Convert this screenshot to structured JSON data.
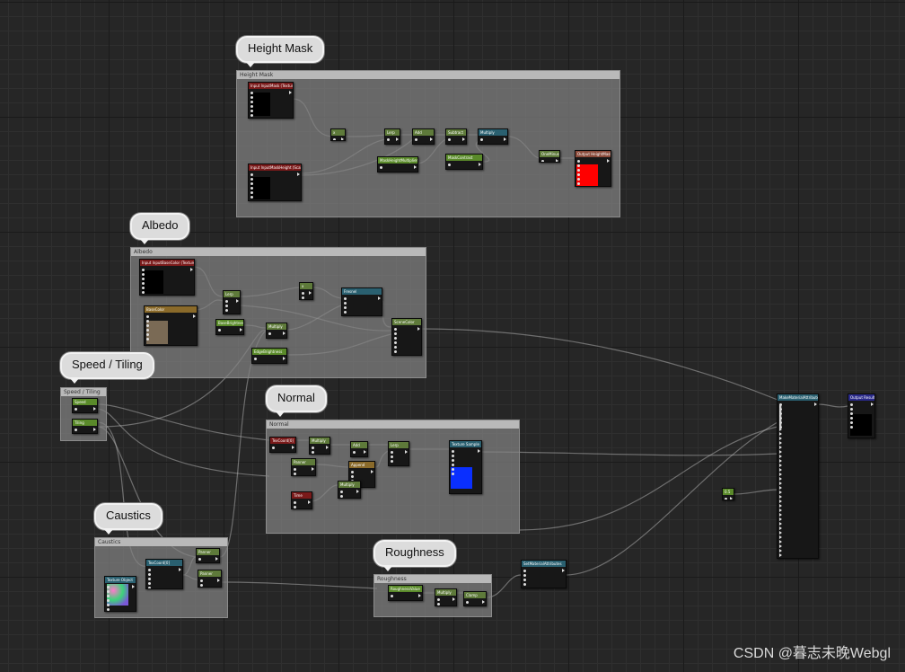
{
  "comments": [
    {
      "id": "height-mask",
      "bubble": "Height Mask",
      "header": "Height Mask"
    },
    {
      "id": "albedo",
      "bubble": "Albedo",
      "header": "Albedo"
    },
    {
      "id": "speed-tiling",
      "bubble": "Speed / Tiling",
      "header": "Speed / Tiling"
    },
    {
      "id": "normal",
      "bubble": "Normal",
      "header": "Normal"
    },
    {
      "id": "caustics",
      "bubble": "Caustics",
      "header": "Caustics"
    },
    {
      "id": "roughness",
      "bubble": "Roughness",
      "header": "Roughness"
    }
  ],
  "nodes": {
    "input_mask_texture": "Input InputMask (Texture)",
    "input_mask_height": "Input InputMaskHeight (Scalar)",
    "mask_mul_a": "x",
    "mask_lerp": "Lerp",
    "mask_add": "Add",
    "mask_subtract": "Subtract",
    "mask_multiply": "Multiply",
    "mask_height_scalar": "MaskHeightMultiplier",
    "mask_contrast_scalar": "MaskContrast",
    "mask_oneminus": "OneMinus",
    "mask_saturate": "Saturate",
    "output_height_mask": "Output HeightMask",
    "albedo_input_color": "Input InputBaseColor (Texture)",
    "albedo_basecolor_param": "BaseColor",
    "albedo_lerp": "Lerp",
    "albedo_multiply": "Multiply",
    "albedo_scalar_a": "BaseBrightness",
    "albedo_scalar_b": "EdgeBrightness",
    "albedo_mul_b": "x",
    "albedo_fresnel": "Fresnel",
    "albedo_scene_depth": "SceneColor",
    "speed_param": "Speed",
    "tiling_param": "Tiling",
    "normal_tex_coord": "TexCoord[0]",
    "normal_multiply": "Multiply",
    "normal_panner": "Panner",
    "normal_add": "Add",
    "normal_append": "Append",
    "normal_time": "Time",
    "normal_scale": "Multiply",
    "normal_lerp": "Lerp",
    "normal_texture_sample": "Texture Sample",
    "caustics_tex_coord": "TexCoord[0]",
    "caustics_sample_a": "Panner",
    "caustics_sample_b": "Panner",
    "caustics_texture": "Texture Object",
    "roughness_param": "RoughnessValue",
    "roughness_multiply": "Multiply",
    "roughness_clamp": "Clamp",
    "roughness_out": "SetMaterialAttributes",
    "result_main": "MakeMaterialAttributes",
    "constant_small": "0.5",
    "output_result": "Output Result"
  },
  "watermark": "CSDN @暮志未晚Webgl"
}
